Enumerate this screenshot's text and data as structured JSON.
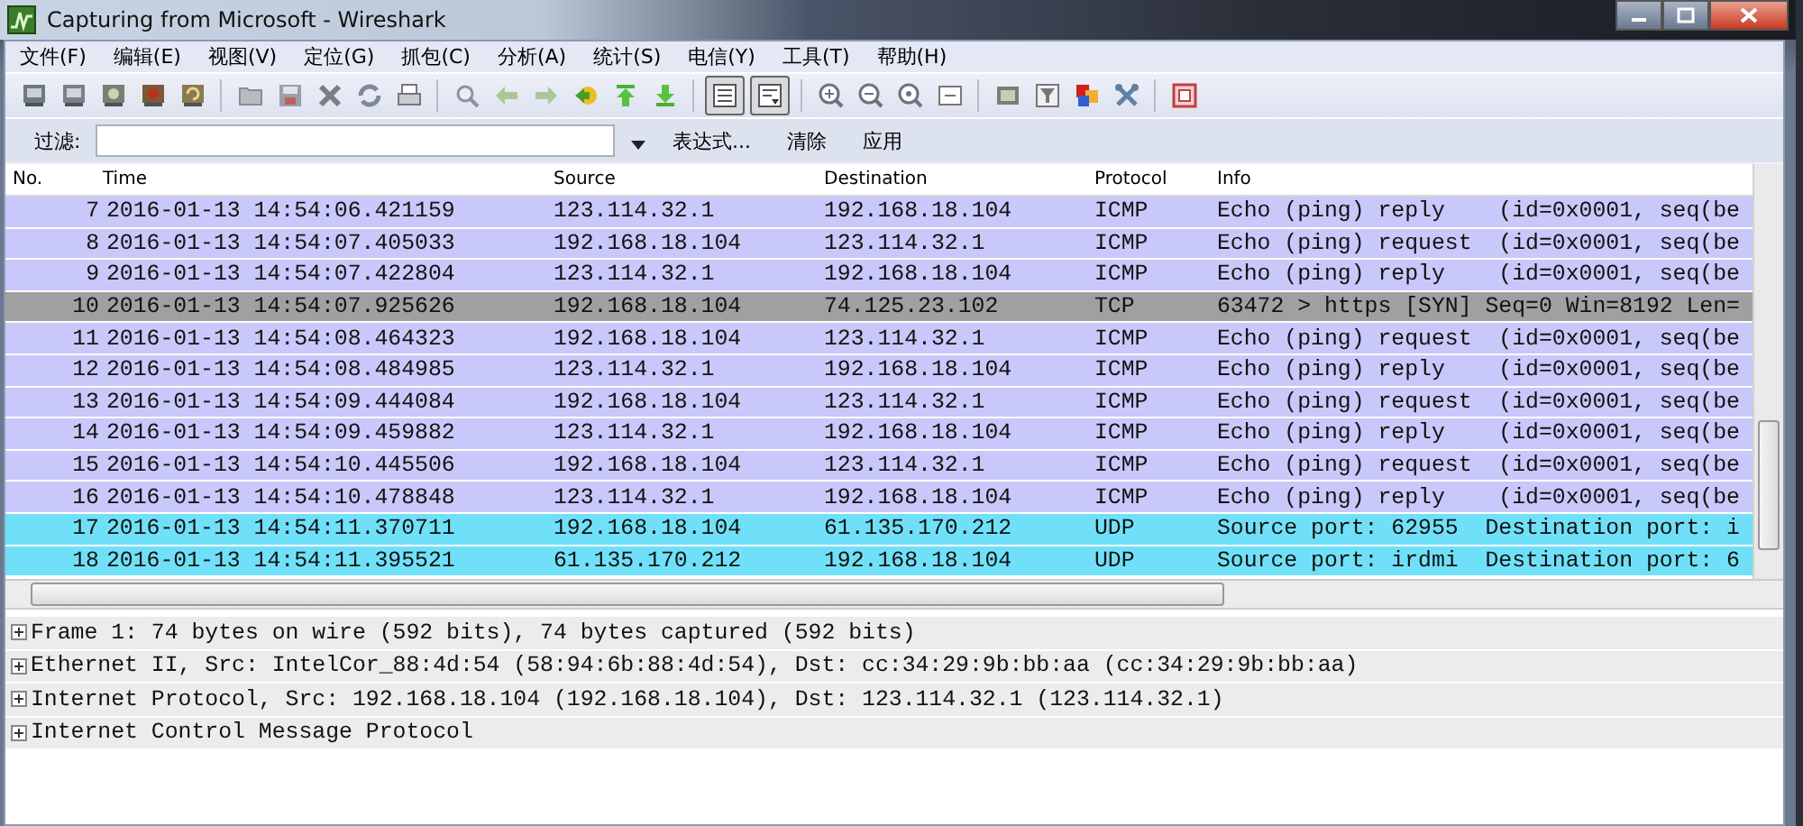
{
  "window": {
    "title": "Capturing from Microsoft - Wireshark"
  },
  "menu": [
    "文件(F)",
    "编辑(E)",
    "视图(V)",
    "定位(G)",
    "抓包(C)",
    "分析(A)",
    "统计(S)",
    "电信(Y)",
    "工具(T)",
    "帮助(H)"
  ],
  "toolbar": [
    {
      "kind": "iface",
      "pressed": false
    },
    {
      "kind": "options",
      "pressed": false
    },
    {
      "kind": "start",
      "pressed": false
    },
    {
      "kind": "stop",
      "pressed": false
    },
    {
      "kind": "restart",
      "pressed": false
    },
    {
      "kind": "sep"
    },
    {
      "kind": "open",
      "pressed": false
    },
    {
      "kind": "save",
      "pressed": false
    },
    {
      "kind": "close",
      "pressed": false
    },
    {
      "kind": "reload",
      "pressed": false
    },
    {
      "kind": "print",
      "pressed": false
    },
    {
      "kind": "sep"
    },
    {
      "kind": "find",
      "pressed": false
    },
    {
      "kind": "back",
      "pressed": false
    },
    {
      "kind": "forward",
      "pressed": false
    },
    {
      "kind": "goto",
      "pressed": false
    },
    {
      "kind": "first",
      "pressed": false
    },
    {
      "kind": "last",
      "pressed": false
    },
    {
      "kind": "sep"
    },
    {
      "kind": "colorize",
      "pressed": true
    },
    {
      "kind": "autoscroll",
      "pressed": true
    },
    {
      "kind": "sep"
    },
    {
      "kind": "zoomin",
      "pressed": false
    },
    {
      "kind": "zoomout",
      "pressed": false
    },
    {
      "kind": "zoomreset",
      "pressed": false
    },
    {
      "kind": "resize",
      "pressed": false
    },
    {
      "kind": "sep"
    },
    {
      "kind": "capfilter",
      "pressed": false
    },
    {
      "kind": "dispfilter",
      "pressed": false
    },
    {
      "kind": "colors",
      "pressed": false
    },
    {
      "kind": "prefs",
      "pressed": false
    },
    {
      "kind": "sep"
    },
    {
      "kind": "help",
      "pressed": false
    }
  ],
  "filter_bar": {
    "label": "过滤:",
    "buttons": [
      "表达式...",
      "清除",
      "应用"
    ]
  },
  "packet_list": {
    "columns": [
      "No.",
      "Time",
      "Source",
      "Destination",
      "Protocol",
      "Info"
    ],
    "rows": [
      {
        "color": "#c8c8fa",
        "cells": [
          "7",
          "2016-01-13 14:54:06.421159",
          "123.114.32.1",
          "192.168.18.104",
          "ICMP",
          "Echo (ping) reply    (id=0x0001, seq(be"
        ]
      },
      {
        "color": "#c8c8fa",
        "cells": [
          "8",
          "2016-01-13 14:54:07.405033",
          "192.168.18.104",
          "123.114.32.1",
          "ICMP",
          "Echo (ping) request  (id=0x0001, seq(be"
        ]
      },
      {
        "color": "#c8c8fa",
        "cells": [
          "9",
          "2016-01-13 14:54:07.422804",
          "123.114.32.1",
          "192.168.18.104",
          "ICMP",
          "Echo (ping) reply    (id=0x0001, seq(be"
        ]
      },
      {
        "color": "#a0a0a0",
        "cells": [
          "10",
          "2016-01-13 14:54:07.925626",
          "192.168.18.104",
          "74.125.23.102",
          "TCP",
          "63472 > https [SYN] Seq=0 Win=8192 Len="
        ]
      },
      {
        "color": "#c8c8fa",
        "cells": [
          "11",
          "2016-01-13 14:54:08.464323",
          "192.168.18.104",
          "123.114.32.1",
          "ICMP",
          "Echo (ping) request  (id=0x0001, seq(be"
        ]
      },
      {
        "color": "#c8c8fa",
        "cells": [
          "12",
          "2016-01-13 14:54:08.484985",
          "123.114.32.1",
          "192.168.18.104",
          "ICMP",
          "Echo (ping) reply    (id=0x0001, seq(be"
        ]
      },
      {
        "color": "#c8c8fa",
        "cells": [
          "13",
          "2016-01-13 14:54:09.444084",
          "192.168.18.104",
          "123.114.32.1",
          "ICMP",
          "Echo (ping) request  (id=0x0001, seq(be"
        ]
      },
      {
        "color": "#c8c8fa",
        "cells": [
          "14",
          "2016-01-13 14:54:09.459882",
          "123.114.32.1",
          "192.168.18.104",
          "ICMP",
          "Echo (ping) reply    (id=0x0001, seq(be"
        ]
      },
      {
        "color": "#c8c8fa",
        "cells": [
          "15",
          "2016-01-13 14:54:10.445506",
          "192.168.18.104",
          "123.114.32.1",
          "ICMP",
          "Echo (ping) request  (id=0x0001, seq(be"
        ]
      },
      {
        "color": "#c8c8fa",
        "cells": [
          "16",
          "2016-01-13 14:54:10.478848",
          "123.114.32.1",
          "192.168.18.104",
          "ICMP",
          "Echo (ping) reply    (id=0x0001, seq(be"
        ]
      },
      {
        "color": "#70e0f8",
        "cells": [
          "17",
          "2016-01-13 14:54:11.370711",
          "192.168.18.104",
          "61.135.170.212",
          "UDP",
          "Source port: 62955  Destination port: i"
        ]
      },
      {
        "color": "#70e0f8",
        "cells": [
          "18",
          "2016-01-13 14:54:11.395521",
          "61.135.170.212",
          "192.168.18.104",
          "UDP",
          "Source port: irdmi  Destination port: 6"
        ]
      }
    ]
  },
  "details": [
    {
      "text": "Frame 1: 74 bytes on wire (592 bits), 74 bytes captured (592 bits)",
      "expanded": false
    },
    {
      "text": "Ethernet II, Src: IntelCor_88:4d:54 (58:94:6b:88:4d:54), Dst: cc:34:29:9b:bb:aa (cc:34:29:9b:bb:aa)",
      "expanded": false
    },
    {
      "text": "Internet Protocol, Src: 192.168.18.104 (192.168.18.104), Dst: 123.114.32.1 (123.114.32.1)",
      "expanded": false
    },
    {
      "text": "Internet Control Message Protocol",
      "expanded": false
    }
  ]
}
